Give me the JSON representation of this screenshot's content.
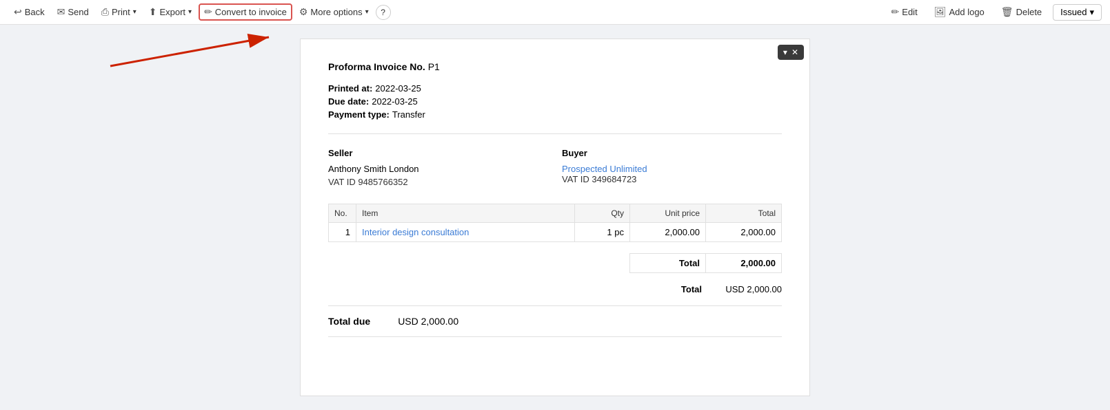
{
  "toolbar": {
    "back_label": "Back",
    "send_label": "Send",
    "print_label": "Print",
    "export_label": "Export",
    "convert_label": "Convert to invoice",
    "more_options_label": "More options",
    "help_label": "?",
    "edit_label": "Edit",
    "add_logo_label": "Add logo",
    "delete_label": "Delete",
    "status_label": "Issued",
    "status_chevron": "▾"
  },
  "invoice": {
    "number_label": "Proforma Invoice No.",
    "number_value": "P1",
    "printed_at_label": "Printed at:",
    "printed_at_value": "2022-03-25",
    "due_date_label": "Due date:",
    "due_date_value": "2022-03-25",
    "payment_type_label": "Payment type:",
    "payment_type_value": "Transfer",
    "seller_title": "Seller",
    "seller_name": "Anthony Smith London",
    "seller_vat": "VAT ID 9485766352",
    "buyer_title": "Buyer",
    "buyer_name": "Prospected Unlimited",
    "buyer_vat": "VAT ID 349684723",
    "table": {
      "col_no": "No.",
      "col_item": "Item",
      "col_qty": "Qty",
      "col_unit_price": "Unit price",
      "col_total": "Total",
      "rows": [
        {
          "no": "1",
          "item": "Interior design consultation",
          "qty": "1 pc",
          "unit_price": "2,000.00",
          "total": "2,000.00"
        }
      ],
      "subtotal_label": "Total",
      "subtotal_value": "2,000.00"
    },
    "total_label": "Total",
    "total_value": "USD 2,000.00",
    "total_due_label": "Total due",
    "total_due_value": "USD 2,000.00"
  },
  "dropdown_panel": {
    "chevron": "▾",
    "close": "✕"
  },
  "arrow": {
    "color": "#cc2200"
  }
}
